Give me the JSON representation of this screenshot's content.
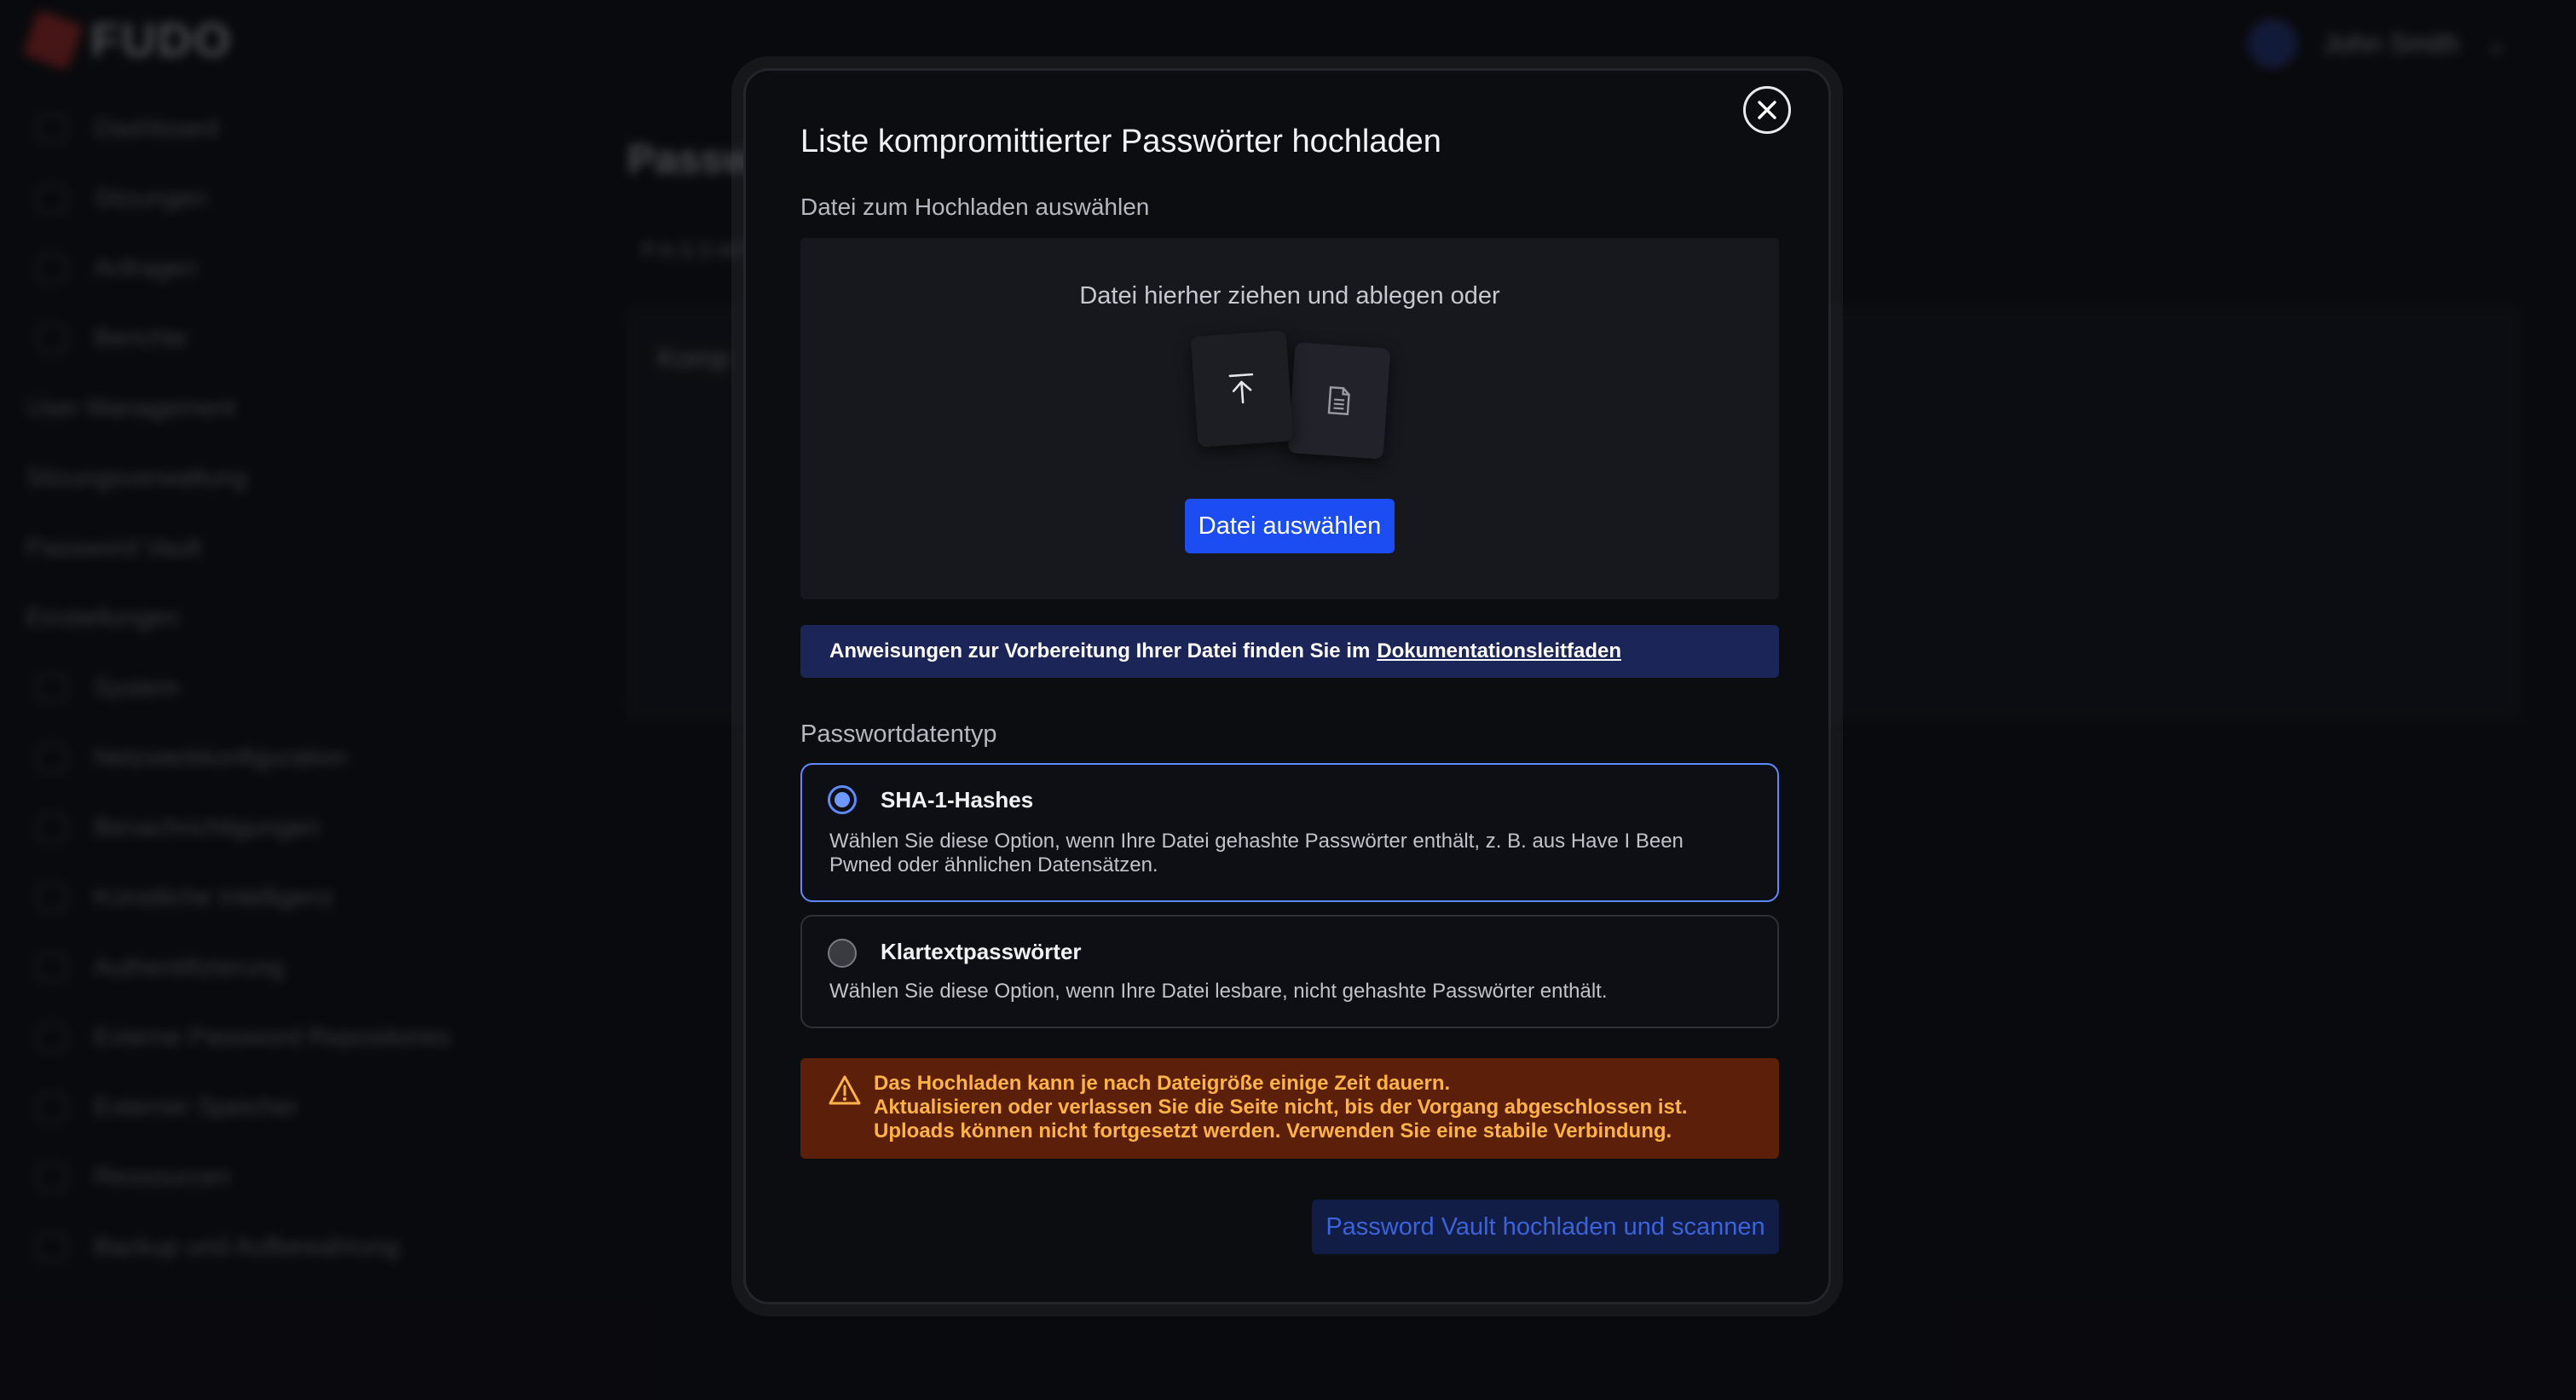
{
  "app": {
    "logo_text": "FUDO",
    "user_name": "John Smith"
  },
  "sidebar": {
    "items_top": [
      "Dashboard",
      "Sitzungen",
      "Anfragen",
      "Berichte"
    ],
    "groups": [
      "User Management",
      "Sitzungsverwaltung",
      "Password Vault",
      "Einstellungen"
    ],
    "settings_items": [
      "System",
      "Netzwerkkonfiguration",
      "Benachrichtigungen",
      "Künstliche Intelligenz",
      "Authentifizierung",
      "Externe Password Repositories",
      "Externer Speicher",
      "Ressourcen",
      "Backup und Aufbewahrung"
    ]
  },
  "background": {
    "page_title": "Passw",
    "tab": "PASSWO",
    "card_title": "Komp"
  },
  "modal": {
    "title": "Liste kompromittierter Passwörter hochladen",
    "file_label": "Datei zum Hochladen auswählen",
    "drop_text": "Datei hierher ziehen und ablegen oder",
    "choose_button": "Datei auswählen",
    "info_text": "Anweisungen zur Vorbereitung Ihrer Datei finden Sie im",
    "info_link": "Dokumentationsleitfaden",
    "type_label": "Passwortdatentyp",
    "options": [
      {
        "title": "SHA-1-Hashes",
        "desc": "Wählen Sie diese Option, wenn Ihre Datei gehashte Passwörter enthält, z. B. aus Have I Been Pwned oder ähnlichen Datensätzen.",
        "selected": true
      },
      {
        "title": "Klartextpasswörter",
        "desc": "Wählen Sie diese Option, wenn Ihre Datei lesbare, nicht gehashte Passwörter enthält.",
        "selected": false
      }
    ],
    "warning_lines": [
      "Das Hochladen kann je nach Dateigröße einige Zeit dauern.",
      "Aktualisieren oder verlassen Sie die Seite nicht, bis der Vorgang abgeschlossen ist.",
      "Uploads können nicht fortgesetzt werden. Verwenden Sie eine stabile Verbindung."
    ],
    "submit_button": "Password Vault hochladen und scannen"
  },
  "colors": {
    "primary": "#1b4df2",
    "selected_border": "#5d8bff",
    "warning_bg": "#5b1f0a",
    "warning_text": "#ffb347",
    "info_bg": "#1c2557"
  }
}
